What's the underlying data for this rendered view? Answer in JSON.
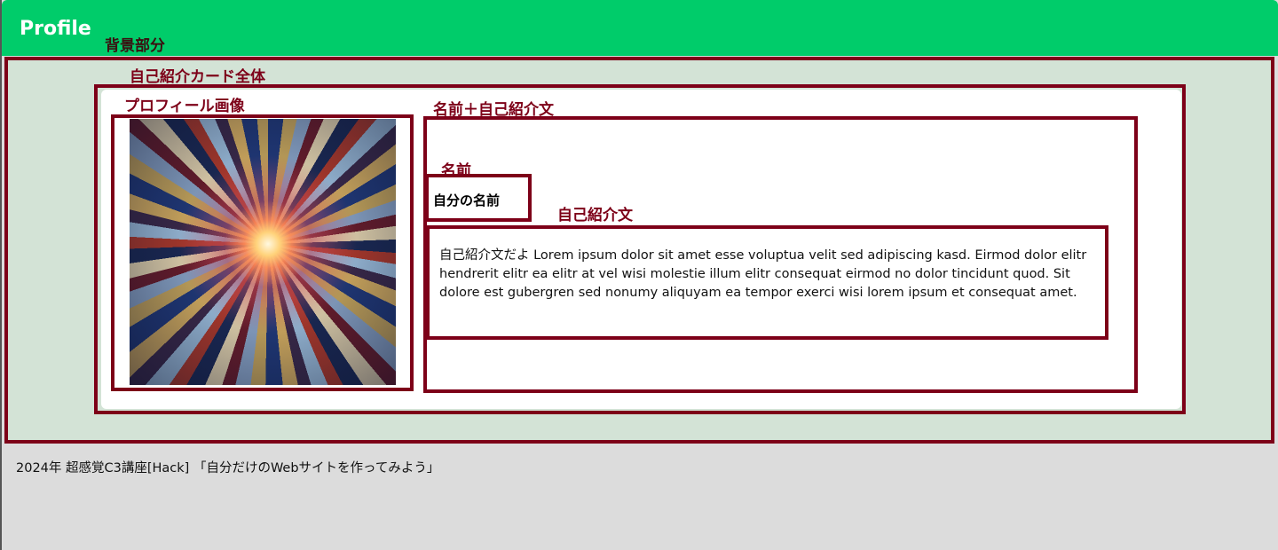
{
  "header": {
    "title": "Profile"
  },
  "annotations": {
    "background": "背景部分",
    "card_whole": "自己紹介カード全体",
    "profile_image": "プロフィール画像",
    "name_and_bio": "名前＋自己紹介文",
    "name": "名前",
    "bio": "自己紹介文"
  },
  "profile": {
    "name": "自分の名前",
    "bio": "自己紹介文だよ Lorem ipsum dolor sit amet esse voluptua velit sed adipiscing kasd. Eirmod dolor elitr hendrerit elitr ea elitr at vel wisi molestie illum elitr consequat eirmod no dolor tincidunt quod. Sit dolore est gubergren sed nonumy aliquyam ea tempor exerci wisi lorem ipsum et consequat amet.",
    "image_alt": "stained-glass-kaleidoscope-image"
  },
  "footer": {
    "text": "2024年 超感覚C3講座[Hack] 「自分だけのWebサイトを作ってみよう」"
  },
  "colors": {
    "header_bg": "#00cc6a",
    "annotation": "#7d0018",
    "section_bg": "#d3e3d6",
    "page_bg": "#dcdcdc"
  }
}
